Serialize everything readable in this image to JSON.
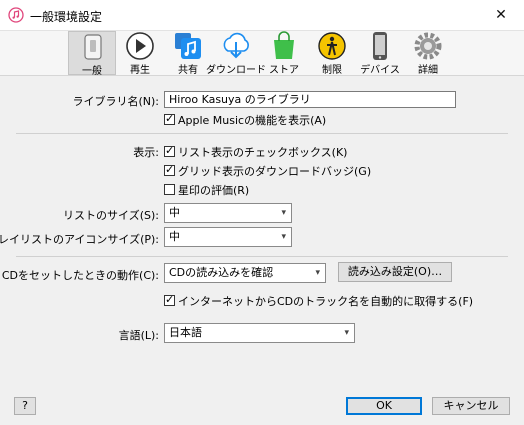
{
  "window": {
    "title": "一般環境設定",
    "close_glyph": "✕"
  },
  "toolbar": {
    "tabs": [
      {
        "label": "一般",
        "icon": "general-icon"
      },
      {
        "label": "再生",
        "icon": "playback-icon"
      },
      {
        "label": "共有",
        "icon": "sharing-icon"
      },
      {
        "label": "ダウンロード",
        "icon": "download-icon"
      },
      {
        "label": "ストア",
        "icon": "store-icon"
      },
      {
        "label": "制限",
        "icon": "restrictions-icon"
      },
      {
        "label": "デバイス",
        "icon": "devices-icon"
      },
      {
        "label": "詳細",
        "icon": "advanced-icon"
      }
    ]
  },
  "general": {
    "library_name_label": "ライブラリ名(N):",
    "library_name_value": "Hiroo Kasuya のライブラリ",
    "apple_music_label": "Apple Musicの機能を表示(A)",
    "apple_music_checked": true,
    "show_label": "表示:",
    "show_checkboxes": [
      {
        "label": "リスト表示のチェックボックス(K)",
        "checked": true
      },
      {
        "label": "グリッド表示のダウンロードバッジ(G)",
        "checked": true
      },
      {
        "label": "星印の評価(R)",
        "checked": false
      }
    ],
    "list_size_label": "リストのサイズ(S):",
    "list_size_value": "中",
    "playlist_icon_size_label": "プレイリストのアイコンサイズ(P):",
    "playlist_icon_size_value": "中",
    "cd_insert_label": "CDをセットしたときの動作(C):",
    "cd_insert_value": "CDの読み込みを確認",
    "import_settings_button": "読み込み設定(O)…",
    "track_names_label": "インターネットからCDのトラック名を自動的に取得する(F)",
    "track_names_checked": true,
    "language_label": "言語(L):",
    "language_value": "日本語"
  },
  "footer": {
    "help_label": "?",
    "ok_label": "OK",
    "cancel_label": "キャンセル"
  },
  "colors": {
    "accent": "#0078d7",
    "background": "#f0f0f0"
  }
}
